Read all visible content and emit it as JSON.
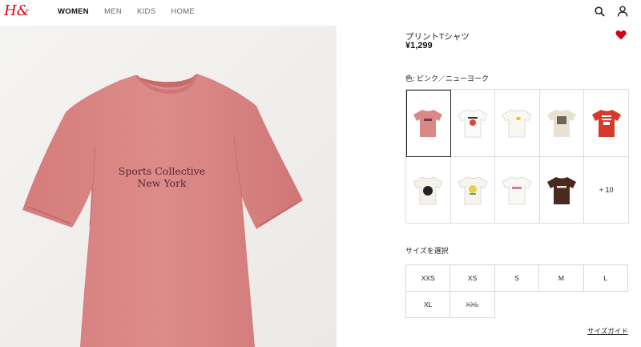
{
  "header": {
    "logo_text": "H&M",
    "nav": [
      {
        "label": "WOMEN",
        "active": true
      },
      {
        "label": "MEN",
        "active": false
      },
      {
        "label": "KIDS",
        "active": false
      },
      {
        "label": "HOME",
        "active": false
      }
    ],
    "icons": [
      "search-icon",
      "account-icon"
    ]
  },
  "product": {
    "print_line1": "Sports Collective",
    "print_line2": "New York",
    "title": "プリントTシャツ",
    "price": "¥1,299",
    "favorite_icon": "heart-icon",
    "favorite_color": "#d0021b",
    "color_label": "色: ピンク／ニューヨーク",
    "swatches": [
      {
        "color": "#d98787",
        "label": "pink",
        "selected": true
      },
      {
        "color": "#ffffff",
        "label": "white-red-print"
      },
      {
        "color": "#f8f7f2",
        "label": "white-small-print"
      },
      {
        "color": "#e8e1d4",
        "label": "beige-print"
      },
      {
        "color": "#d63a2b",
        "label": "red-surf-beach"
      },
      {
        "color": "#f4f1ea",
        "label": "white-black-flower"
      },
      {
        "color": "#f6f4ec",
        "label": "white-lemon"
      },
      {
        "color": "#faf8f5",
        "label": "white-text-print"
      },
      {
        "color": "#4a2a1e",
        "label": "brown-atelier"
      }
    ],
    "more_colors": "+ 10",
    "size_label": "サイズを選択",
    "sizes": [
      {
        "label": "XXS",
        "available": true
      },
      {
        "label": "XS",
        "available": true
      },
      {
        "label": "S",
        "available": true
      },
      {
        "label": "M",
        "available": true
      },
      {
        "label": "L",
        "available": true
      },
      {
        "label": "XL",
        "available": true
      },
      {
        "label": "XXL",
        "available": false
      }
    ],
    "size_guide": "サイズガイド"
  }
}
